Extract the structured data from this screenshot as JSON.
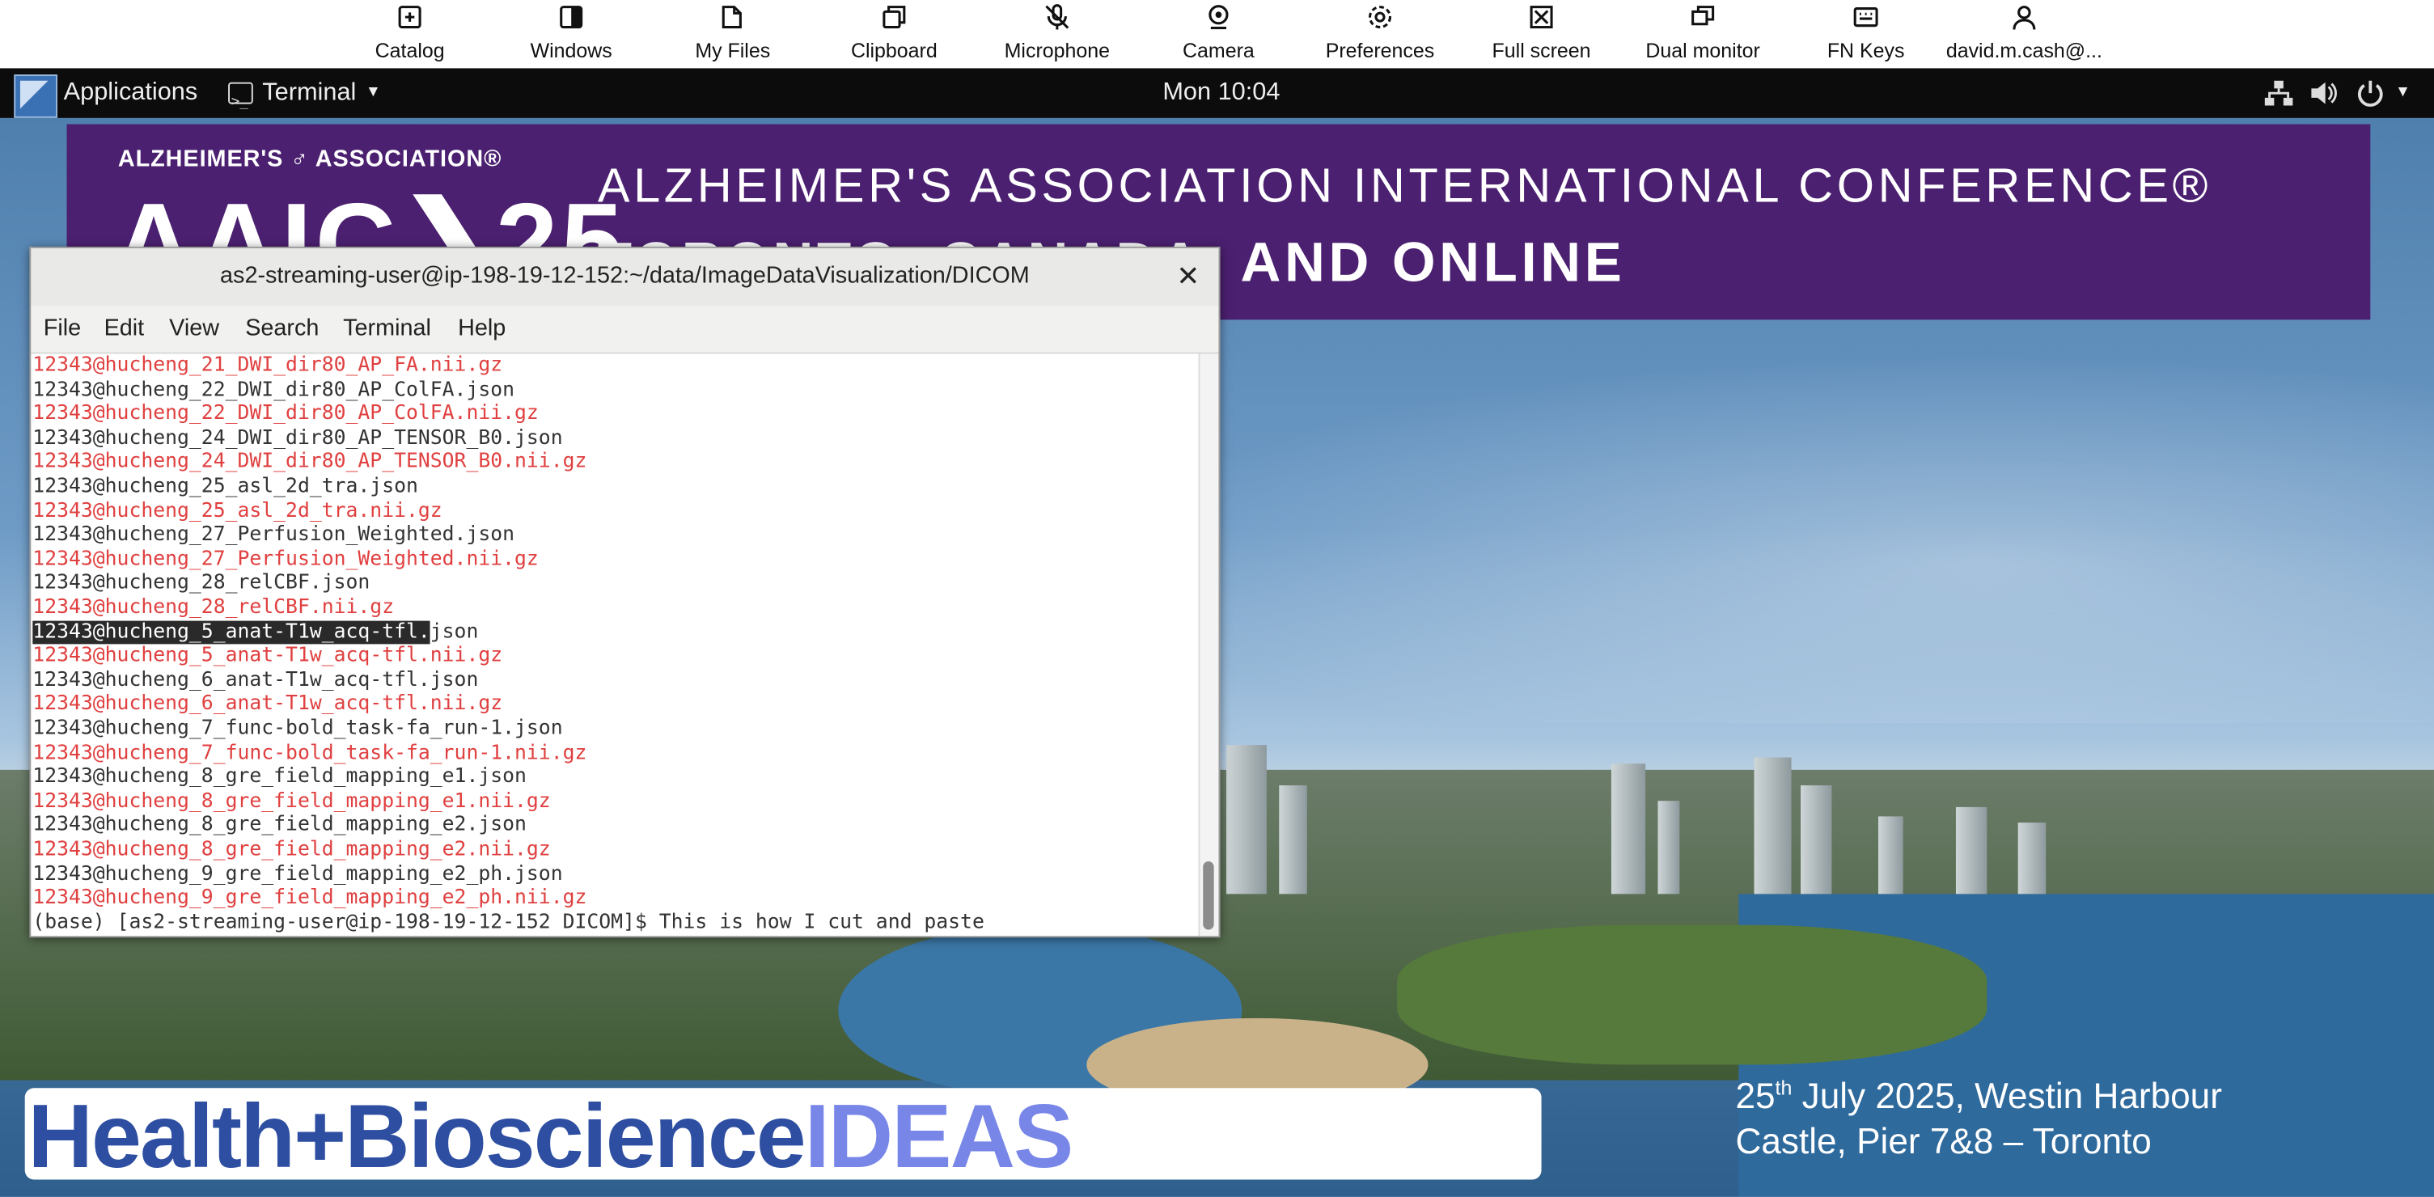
{
  "toolbar": {
    "items": [
      {
        "label": "Catalog",
        "icon": "plus-square-icon"
      },
      {
        "label": "Windows",
        "icon": "window-icon"
      },
      {
        "label": "My Files",
        "icon": "folder-icon"
      },
      {
        "label": "Clipboard",
        "icon": "clipboard-icon"
      },
      {
        "label": "Microphone",
        "icon": "microphone-off-icon"
      },
      {
        "label": "Camera",
        "icon": "camera-icon"
      },
      {
        "label": "Preferences",
        "icon": "gear-icon"
      },
      {
        "label": "Full screen",
        "icon": "fullscreen-icon"
      },
      {
        "label": "Dual monitor",
        "icon": "dual-monitor-icon"
      },
      {
        "label": "FN Keys",
        "icon": "keyboard-icon"
      },
      {
        "label": "david.m.cash@...",
        "icon": "user-icon"
      }
    ]
  },
  "panel": {
    "applications": "Applications",
    "terminal": "Terminal",
    "clock": "Mon 10:04"
  },
  "banner": {
    "association": "ALZHEIMER'S ♂ ASSOCIATION®",
    "aaic": "AAIC❯25",
    "line1": "ALZHEIMER'S ASSOCIATION INTERNATIONAL CONFERENCE®",
    "line2": "TORONTO, CANADA, AND ONLINE"
  },
  "event": {
    "line1_day": "25",
    "line1_suffix": "th",
    "line1_rest": " July 2025, Westin Harbour",
    "line2": "Castle, Pier 7&8 – Toronto"
  },
  "ideas": {
    "part1": "Health+Bioscience",
    "part2": "IDEAS"
  },
  "terminal": {
    "title": "as2-streaming-user@ip-198-19-12-152:~/data/ImageDataVisualization/DICOM",
    "menu": [
      "File",
      "Edit",
      "View",
      "Search",
      "Terminal",
      "Help"
    ],
    "lines": [
      {
        "text": "12343@hucheng_21_DWI_dir80_AP_FA.nii.gz",
        "red": true
      },
      {
        "text": "12343@hucheng_22_DWI_dir80_AP_ColFA.json",
        "red": false
      },
      {
        "text": "12343@hucheng_22_DWI_dir80_AP_ColFA.nii.gz",
        "red": true
      },
      {
        "text": "12343@hucheng_24_DWI_dir80_AP_TENSOR_B0.json",
        "red": false
      },
      {
        "text": "12343@hucheng_24_DWI_dir80_AP_TENSOR_B0.nii.gz",
        "red": true
      },
      {
        "text": "12343@hucheng_25_asl_2d_tra.json",
        "red": false
      },
      {
        "text": "12343@hucheng_25_asl_2d_tra.nii.gz",
        "red": true
      },
      {
        "text": "12343@hucheng_27_Perfusion_Weighted.json",
        "red": false
      },
      {
        "text": "12343@hucheng_27_Perfusion_Weighted.nii.gz",
        "red": true
      },
      {
        "text": "12343@hucheng_28_relCBF.json",
        "red": false
      },
      {
        "text": "12343@hucheng_28_relCBF.nii.gz",
        "red": true
      },
      {
        "text": "12343@hucheng_5_anat-T1w_acq-tfl.",
        "selected": true,
        "rest": "json",
        "red": false
      },
      {
        "text": "12343@hucheng_5_anat-T1w_acq-tfl.nii.gz",
        "red": true
      },
      {
        "text": "12343@hucheng_6_anat-T1w_acq-tfl.json",
        "red": false
      },
      {
        "text": "12343@hucheng_6_anat-T1w_acq-tfl.nii.gz",
        "red": true
      },
      {
        "text": "12343@hucheng_7_func-bold_task-fa_run-1.json",
        "red": false
      },
      {
        "text": "12343@hucheng_7_func-bold_task-fa_run-1.nii.gz",
        "red": true
      },
      {
        "text": "12343@hucheng_8_gre_field_mapping_e1.json",
        "red": false
      },
      {
        "text": "12343@hucheng_8_gre_field_mapping_e1.nii.gz",
        "red": true
      },
      {
        "text": "12343@hucheng_8_gre_field_mapping_e2.json",
        "red": false
      },
      {
        "text": "12343@hucheng_8_gre_field_mapping_e2.nii.gz",
        "red": true
      },
      {
        "text": "12343@hucheng_9_gre_field_mapping_e2_ph.json",
        "red": false
      },
      {
        "text": "12343@hucheng_9_gre_field_mapping_e2_ph.nii.gz",
        "red": true
      },
      {
        "text": "(base) [as2-streaming-user@ip-198-19-12-152 DICOM]$ This is how I cut and paste",
        "red": false
      }
    ]
  },
  "colors": {
    "terminal_red": "#e04040",
    "banner_purple": "#4b2070",
    "ideas_blue": "#2d4ea1",
    "ideas_violet": "#7886e8"
  }
}
